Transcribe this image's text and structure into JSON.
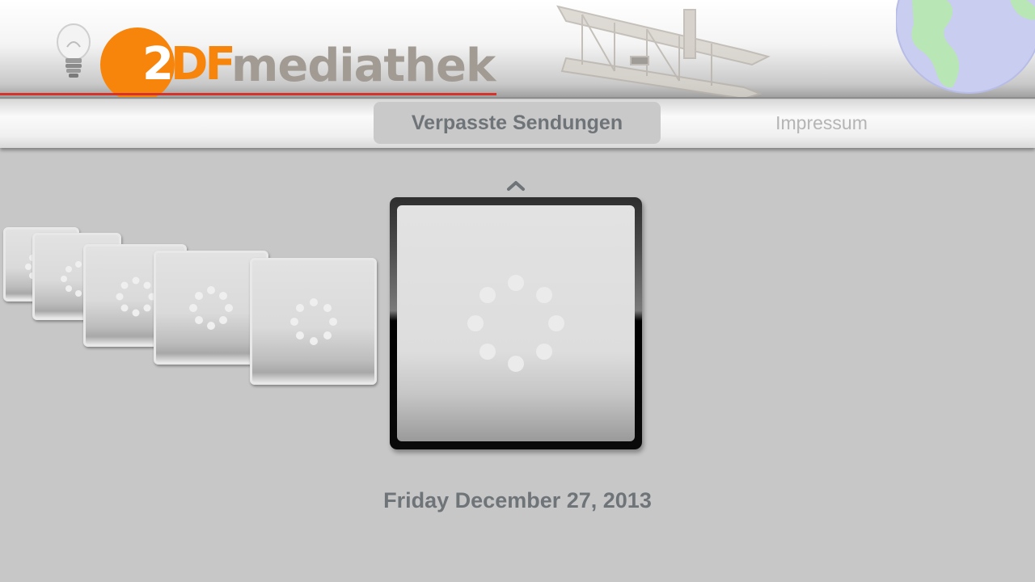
{
  "header": {
    "logo": {
      "brand_prefix_white": "2",
      "brand_prefix_orange": "DF",
      "brand_suffix": "mediathek"
    },
    "icons": [
      "lightbulb-icon",
      "biplane-illustration",
      "globe-illustration"
    ],
    "colors": {
      "brand_orange": "#f7850c",
      "brand_gray": "#a19b93",
      "accent_red": "#d6322b"
    }
  },
  "nav": {
    "tabs": [
      {
        "label": "Verpasste Sendungen",
        "selected": true
      },
      {
        "label": "Impressum",
        "selected": false
      }
    ]
  },
  "carousel": {
    "icons": [
      "chevron-up-icon",
      "loading-spinner-icon"
    ],
    "thumbnail_count": 6,
    "selected_index": 5,
    "selected_date": "Friday December 27, 2013"
  },
  "colors": {
    "background": "#c7c7c7",
    "text_dark": "#6f7479",
    "text_light": "#b4b4b4"
  }
}
